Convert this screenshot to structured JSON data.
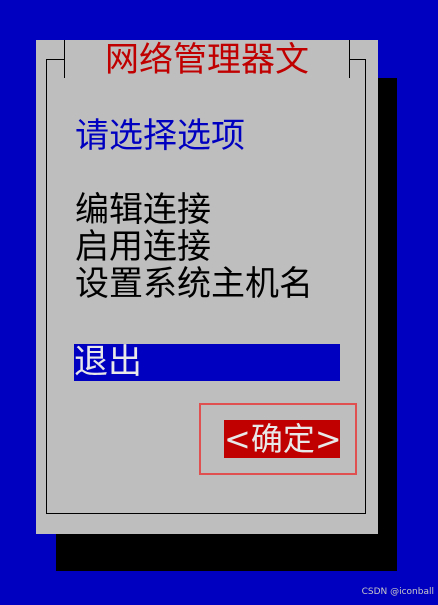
{
  "dialog": {
    "title": "网络管理器文",
    "prompt": "请选择选项",
    "menu_items": [
      {
        "label": "编辑连接",
        "selected": false
      },
      {
        "label": "启用连接",
        "selected": false
      },
      {
        "label": "设置系统主机名",
        "selected": false
      },
      {
        "label": "退出",
        "selected": true
      }
    ],
    "ok_button": {
      "label": "<确定>"
    }
  },
  "watermark": "CSDN @iconball",
  "colors": {
    "screen_background": "#0000c0",
    "dialog_background": "#bebebe",
    "title_text": "#c00000",
    "prompt_text": "#0000c0",
    "menu_text": "#000000",
    "selected_background": "#0000c0",
    "selected_text": "#e8e8e8",
    "button_background": "#c00000",
    "button_text": "#e8e8e8",
    "highlight_box": "#e05050"
  }
}
